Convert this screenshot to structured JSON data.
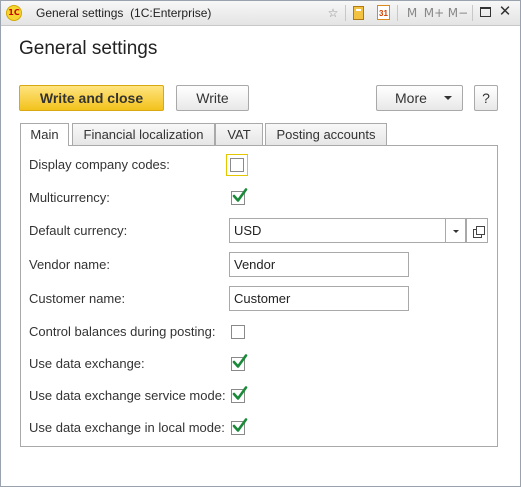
{
  "window": {
    "title": "General settings",
    "app_name": "(1C:Enterprise)",
    "logo_text": "1С"
  },
  "toolbar_icons": {
    "star": "☆",
    "calendar_day": "31",
    "m": "M",
    "m_plus": "M+",
    "m_minus": "M−"
  },
  "form": {
    "title": "General settings"
  },
  "buttons": {
    "write_and_close": "Write and close",
    "write": "Write",
    "more": "More",
    "help": "?"
  },
  "tabs": [
    {
      "label": "Main",
      "active": true
    },
    {
      "label": "Financial localization",
      "active": false
    },
    {
      "label": "VAT",
      "active": false
    },
    {
      "label": "Posting accounts",
      "active": false
    }
  ],
  "fields": {
    "display_company_codes": {
      "label": "Display company codes:",
      "checked": false
    },
    "multicurrency": {
      "label": "Multicurrency:",
      "checked": true
    },
    "default_currency": {
      "label": "Default currency:",
      "value": "USD"
    },
    "vendor_name": {
      "label": "Vendor name:",
      "value": "Vendor"
    },
    "customer_name": {
      "label": "Customer name:",
      "value": "Customer"
    },
    "control_balances": {
      "label": "Control balances during posting:",
      "checked": false
    },
    "use_data_exchange": {
      "label": "Use data exchange:",
      "checked": true
    },
    "use_data_exchange_service": {
      "label": "Use data exchange service mode:",
      "checked": true
    },
    "use_data_exchange_local": {
      "label": "Use data exchange in local mode:",
      "checked": true
    }
  },
  "colors": {
    "primary_button": "#f2c21c",
    "checkmark": "#1a8a3a",
    "focus_border": "#e5c700"
  }
}
